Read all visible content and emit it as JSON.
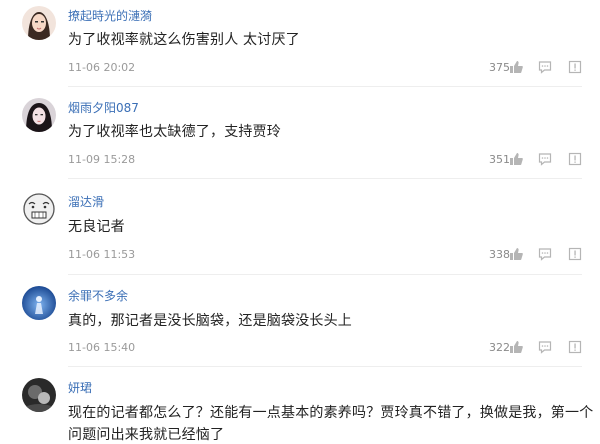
{
  "comments": [
    {
      "username": "撩起時光的漣漪",
      "content": "为了收视率就这么伤害别人 太讨厌了",
      "time": "11-06 20:02",
      "likes": "375",
      "avatar": "female-portrait"
    },
    {
      "username": "烟雨夕阳087",
      "content": "为了收视率也太缺德了，支持贾玲",
      "time": "11-09 15:28",
      "likes": "351",
      "avatar": "female-portrait-dark-hair"
    },
    {
      "username": "溜达滑",
      "content": "无良记者",
      "time": "11-06 11:53",
      "likes": "338",
      "avatar": "meme-face"
    },
    {
      "username": "余罪不多余",
      "content": "真的，那记者是没长脑袋，还是脑袋没长头上",
      "time": "11-06 15:40",
      "likes": "322",
      "avatar": "blue-figure"
    },
    {
      "username": "妍珺",
      "content": "现在的记者都怎么了？还能有一点基本的素养吗？贾玲真不错了，换做是我，第一个",
      "content_line2": "问题问出来我就已经恼了",
      "avatar": "dark-photo"
    }
  ],
  "icons": {
    "like": "thumbs-up-icon",
    "comment": "comment-bubble-icon",
    "report": "report-flag-icon"
  },
  "colors": {
    "username": "#3b6fb6",
    "text": "#222222",
    "meta": "#9a9a9a"
  }
}
